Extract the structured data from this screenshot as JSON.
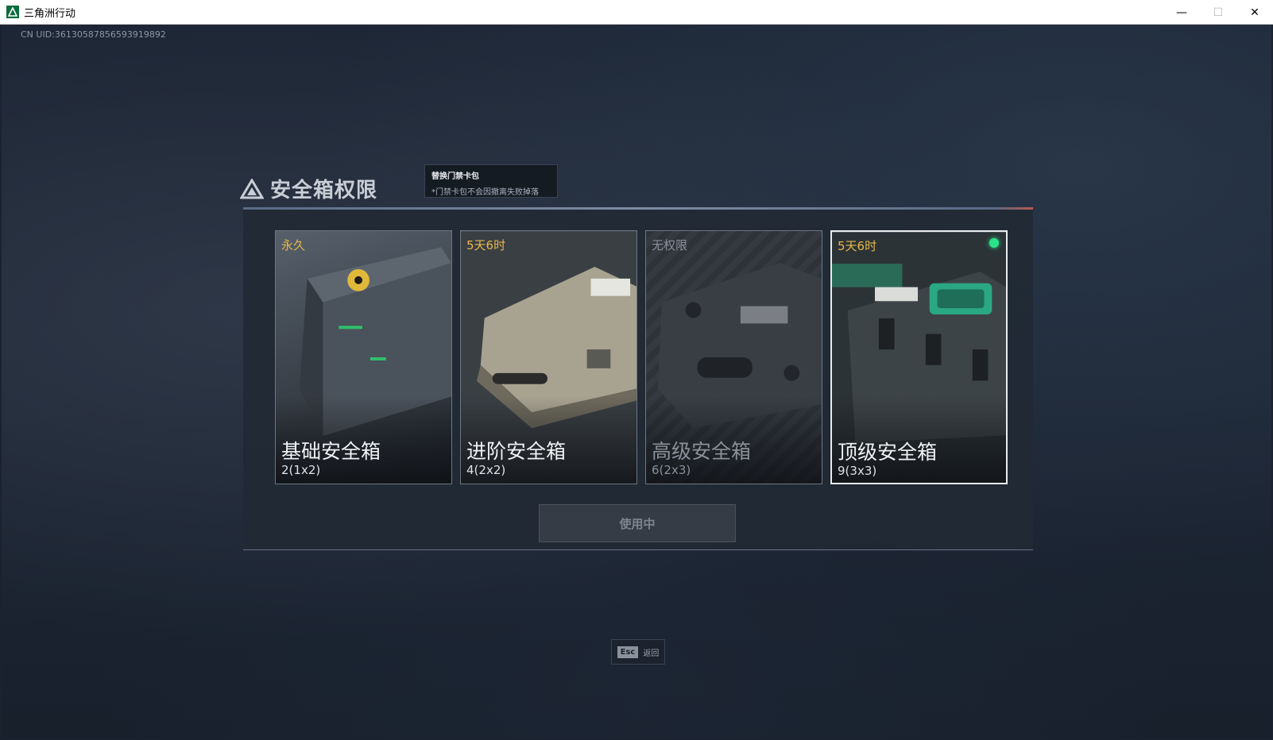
{
  "window": {
    "title": "三角洲行动",
    "controls": {
      "minimize": "—",
      "maximize": "☐",
      "close": "✕"
    }
  },
  "uid_text": "CN UID:36130587856593919892",
  "panel": {
    "title": "安全箱权限",
    "tooltip": {
      "title": "替换门禁卡包",
      "note": "*门禁卡包不会因撤离失败掉落"
    },
    "cards": [
      {
        "tag": "永久",
        "name": "基础安全箱",
        "capacity": "2(1x2)",
        "state": "owned"
      },
      {
        "tag": "5天6时",
        "name": "进阶安全箱",
        "capacity": "4(2x2)",
        "state": "owned"
      },
      {
        "tag": "无权限",
        "name": "高级安全箱",
        "capacity": "6(2x3)",
        "state": "locked"
      },
      {
        "tag": "5天6时",
        "name": "顶级安全箱",
        "capacity": "9(3x3)",
        "state": "selected"
      }
    ],
    "action_button": "使用中"
  },
  "esc_hint": {
    "key": "Esc",
    "label": "返回"
  },
  "colors": {
    "accent_gold": "#e8b84a",
    "active_green": "#2be38a",
    "background": "#1b2433"
  }
}
